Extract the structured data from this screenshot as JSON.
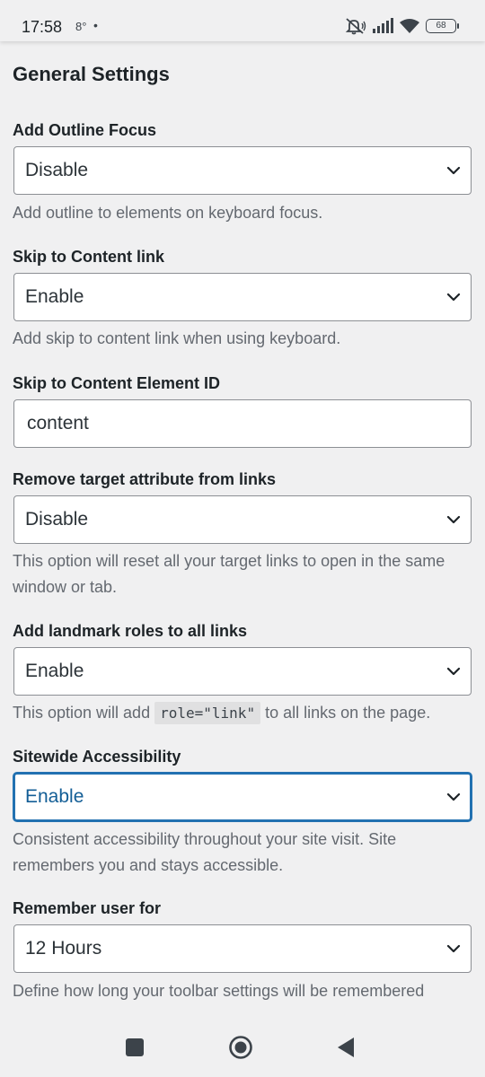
{
  "status_bar": {
    "time": "17:58",
    "temperature": "8°",
    "dot": "•",
    "battery": "68"
  },
  "page": {
    "title": "General Settings"
  },
  "fields": {
    "outline_focus": {
      "label": "Add Outline Focus",
      "value": "Disable",
      "description": "Add outline to elements on keyboard focus."
    },
    "skip_link": {
      "label": "Skip to Content link",
      "value": "Enable",
      "description": "Add skip to content link when using keyboard."
    },
    "skip_element_id": {
      "label": "Skip to Content Element ID",
      "value": "content"
    },
    "remove_target": {
      "label": "Remove target attribute from links",
      "value": "Disable",
      "description": "This option will reset all your target links to open in the same window or tab."
    },
    "landmark_roles": {
      "label": "Add landmark roles to all links",
      "value": "Enable",
      "description_before": "This option will add",
      "description_code": "role=\"link\"",
      "description_after": "to all links on the page."
    },
    "sitewide": {
      "label": "Sitewide Accessibility",
      "value": "Enable",
      "description": "Consistent accessibility throughout your site visit. Site remembers you and stays accessible."
    },
    "remember_user": {
      "label": "Remember user for",
      "value": "12 Hours",
      "description": "Define how long your toolbar settings will be remembered"
    }
  },
  "colors": {
    "focus_accent": "#2271b1",
    "background": "#f0f0f1"
  },
  "icons": {
    "status": [
      "mute-icon",
      "signal-icon",
      "wifi-icon",
      "battery-icon"
    ],
    "dropdown": "chevron-down-icon",
    "nav": [
      "recent-apps-icon",
      "home-icon",
      "back-icon"
    ]
  }
}
